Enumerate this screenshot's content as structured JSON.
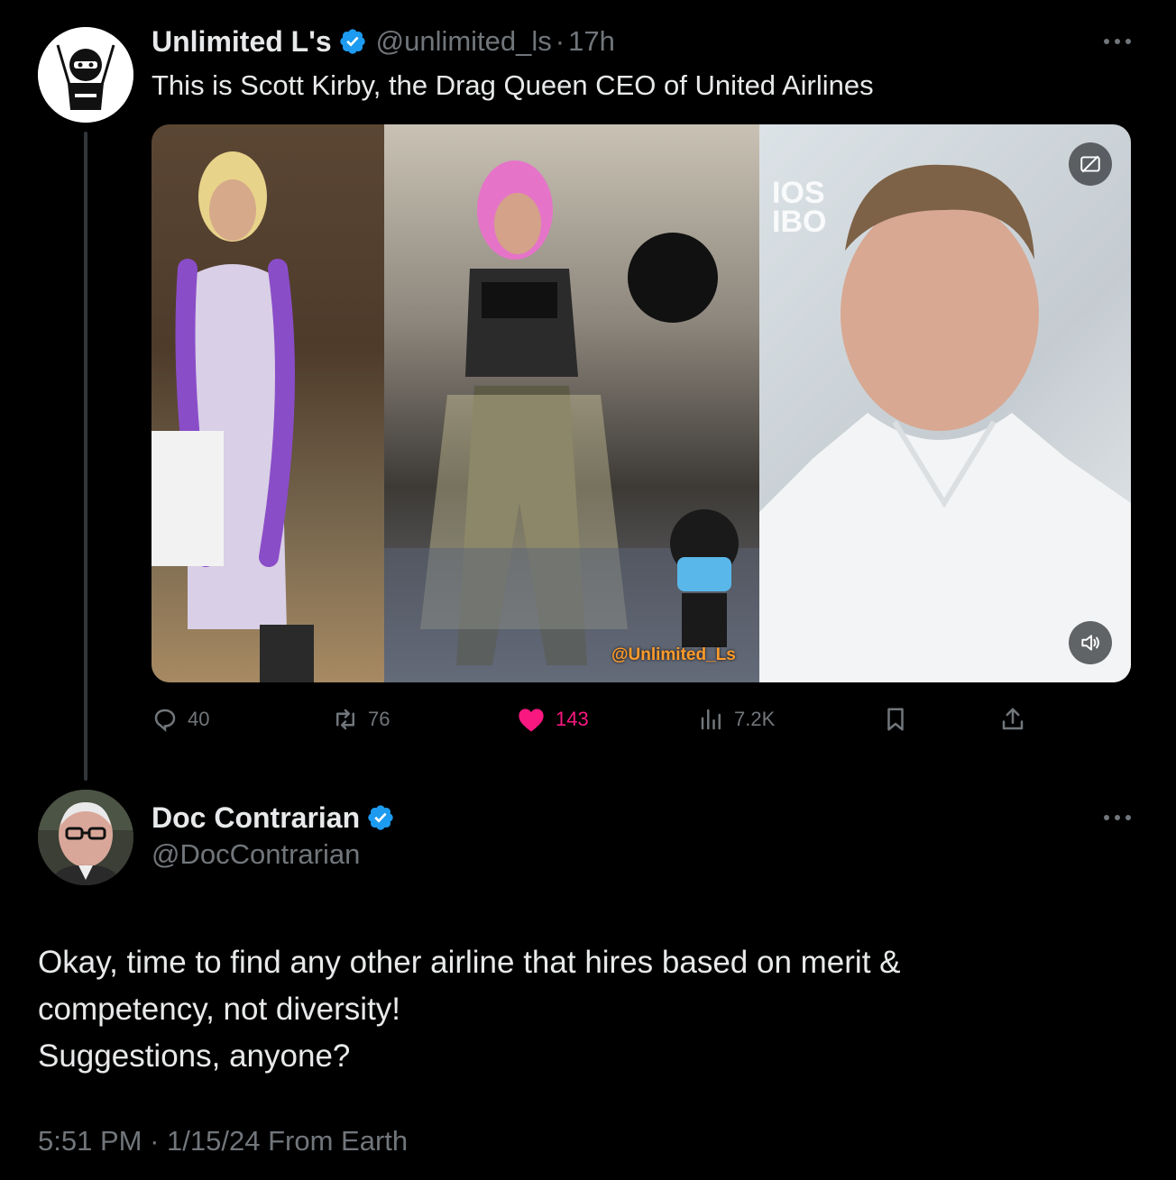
{
  "parent_tweet": {
    "author_name": "Unlimited L's",
    "handle": "@unlimited_ls",
    "separator": "·",
    "time": "17h",
    "text": "This is Scott Kirby, the Drag Queen CEO of United Airlines",
    "media": {
      "watermark": "@Unlimited_Ls",
      "overlay_text_line1": "IOS",
      "overlay_text_line2": "IBO"
    },
    "stats": {
      "replies": "40",
      "retweets": "76",
      "likes": "143",
      "views": "7.2K"
    }
  },
  "reply_tweet": {
    "author_name": "Doc Contrarian",
    "handle": "@DocContrarian",
    "text_lines": [
      "Okay, time to find any other airline that hires based on merit &",
      "competency, not diversity!",
      "Suggestions, anyone?"
    ],
    "time": "5:51 PM",
    "separator": "·",
    "date": "1/15/24",
    "source": "From Earth"
  },
  "colors": {
    "background": "#000000",
    "text": "#e7e9ea",
    "secondary": "#71767b",
    "verified": "#1d9bf0",
    "like": "#f91880"
  },
  "icons": [
    "verified-badge-icon",
    "more-icon",
    "reply-icon",
    "retweet-icon",
    "like-icon",
    "views-icon",
    "bookmark-icon",
    "share-icon",
    "gif-icon",
    "volume-icon"
  ]
}
